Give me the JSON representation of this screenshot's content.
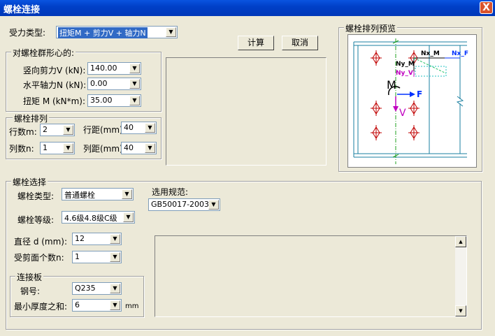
{
  "window": {
    "title": "螺栓连接",
    "close": "X"
  },
  "force_type": {
    "label": "受力类型:",
    "value": "扭矩M + 剪力V + 轴力N"
  },
  "buttons": {
    "calc": "计算",
    "cancel": "取消"
  },
  "centroid_group": {
    "title": "对螺栓群形心的:",
    "shear_label": "竖向剪力V (kN):",
    "shear_value": "140.00",
    "axial_label": "水平轴力N (kN):",
    "axial_value": "0.00",
    "torque_label": "扭矩  M (kN*m):",
    "torque_value": "35.00"
  },
  "arrangement": {
    "title": "螺栓排列",
    "rows_label": "行数m:",
    "rows_value": "2",
    "row_spacing_label": "行距(mm):",
    "row_spacing_value": "40",
    "cols_label": "列数n:",
    "cols_value": "1",
    "col_spacing_label": "列距(mm):",
    "col_spacing_value": "40"
  },
  "preview": {
    "title": "螺栓排列预览",
    "labels": {
      "nx_m": "Nx_M",
      "nx_f": "Nx_F",
      "ny_m": "Ny_M",
      "ny_v": "Ny_V",
      "m": "M",
      "f": "F",
      "v": "V"
    }
  },
  "bolt_select": {
    "title": "螺栓选择",
    "type_label": "螺栓类型:",
    "type_value": "普通螺栓",
    "grade_label": "螺栓等级:",
    "grade_value": "4.6级4.8级C级",
    "code_label": "选用规范:",
    "code_value": "GB50017-2003",
    "diameter_label": "直径 d (mm):",
    "diameter_value": "12",
    "shear_planes_label": "受剪面个数n:",
    "shear_planes_value": "1"
  },
  "plate": {
    "title": "连接板",
    "steel_label": "钢号:",
    "steel_value": "Q235",
    "thickness_label": "最小厚度之和:",
    "thickness_value": "6",
    "thickness_unit": "mm"
  },
  "scroll": {
    "up": "▲",
    "down": "▼"
  },
  "dropdown_arrow": "▼"
}
